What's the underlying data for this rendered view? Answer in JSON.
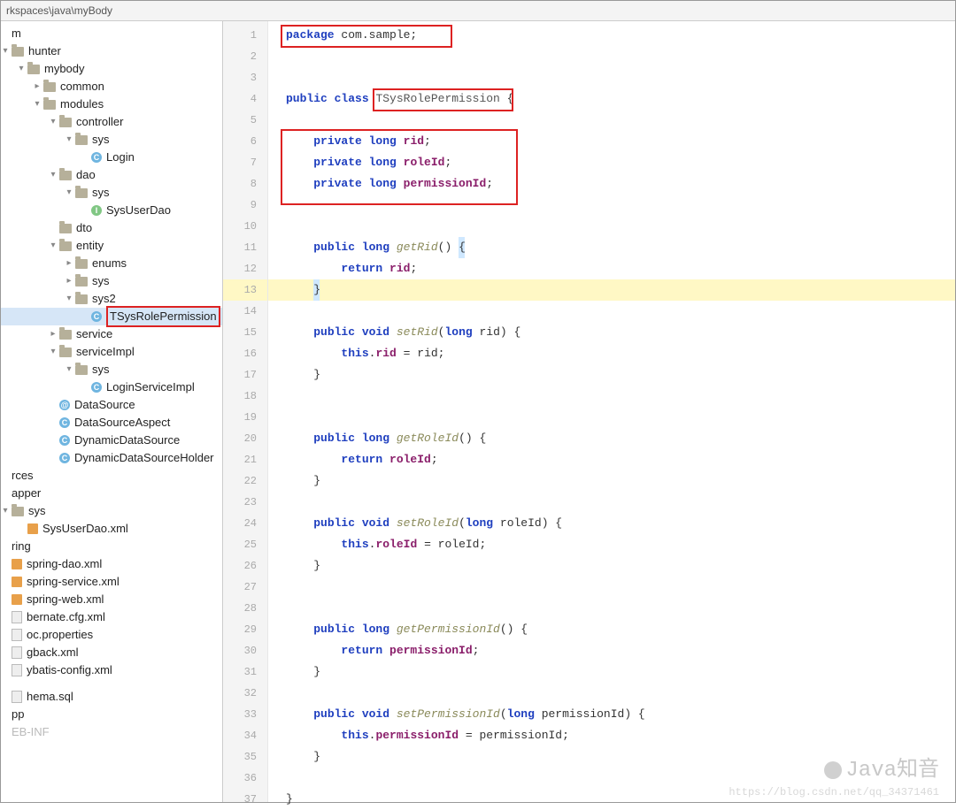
{
  "pathbar": "rkspaces\\java\\myBody",
  "tree": {
    "hunter": "hunter",
    "mybody": "mybody",
    "common": "common",
    "modules": "modules",
    "controller": "controller",
    "ctrl_sys": "sys",
    "Login": "Login",
    "dao": "dao",
    "dao_sys": "sys",
    "SysUserDao": "SysUserDao",
    "dto": "dto",
    "entity": "entity",
    "enums": "enums",
    "sys": "sys",
    "sys2": "sys2",
    "TSysRolePermission": "TSysRolePermission",
    "service": "service",
    "serviceImpl": "serviceImpl",
    "si_sys": "sys",
    "LoginServiceImpl": "LoginServiceImpl",
    "DataSource": "DataSource",
    "DataSourceAspect": "DataSourceAspect",
    "DynamicDataSource": "DynamicDataSource",
    "DynamicDataSourceHolder": "DynamicDataSourceHolder",
    "rces": "rces",
    "apper": "apper",
    "sys_folder": "sys",
    "SysUserDao_xml": "SysUserDao.xml",
    "ring": "ring",
    "spring_dao": "spring-dao.xml",
    "spring_service": "spring-service.xml",
    "spring_web": "spring-web.xml",
    "bernate": "bernate.cfg.xml",
    "oc_prop": "oc.properties",
    "gback": "gback.xml",
    "ybatis": "ybatis-config.xml",
    "hema": "hema.sql",
    "pp": "pp",
    "inf": "EB-INF",
    "m": "m"
  },
  "code": {
    "l1_a": "package",
    "l1_b": " com.sample;",
    "l4_a": "public class",
    "l4_cn": "TSysRolePermission",
    "l4_c": " {",
    "l6_a": "private long ",
    "l6_f": "rid",
    "l6_s": ";",
    "l7_a": "private long ",
    "l7_f": "roleId",
    "l7_s": ";",
    "l8_a": "private long ",
    "l8_f": "permissionId",
    "l8_s": ";",
    "l11_a": "public long ",
    "l11_m": "getRid",
    "l11_b": "() ",
    "l11_c": "{",
    "l12_a": "return ",
    "l12_f": "rid",
    "l12_s": ";",
    "l13": "}",
    "l15_a": "public void ",
    "l15_m": "setRid",
    "l15_b": "(",
    "l15_k": "long",
    "l15_c": " rid) {",
    "l16_a": "this",
    "l16_b": ".",
    "l16_f": "rid",
    "l16_c": " = rid;",
    "l17": "}",
    "l20_a": "public long ",
    "l20_m": "getRoleId",
    "l20_b": "() {",
    "l21_a": "return ",
    "l21_f": "roleId",
    "l21_s": ";",
    "l22": "}",
    "l24_a": "public void ",
    "l24_m": "setRoleId",
    "l24_b": "(",
    "l24_k": "long",
    "l24_c": " roleId) {",
    "l25_a": "this",
    "l25_b": ".",
    "l25_f": "roleId",
    "l25_c": " = roleId;",
    "l26": "}",
    "l29_a": "public long ",
    "l29_m": "getPermissionId",
    "l29_b": "() {",
    "l30_a": "return ",
    "l30_f": "permissionId",
    "l30_s": ";",
    "l31": "}",
    "l33_a": "public void ",
    "l33_m": "setPermissionId",
    "l33_b": "(",
    "l33_k": "long",
    "l33_c": " permissionId) {",
    "l34_a": "this",
    "l34_b": ".",
    "l34_f": "permissionId",
    "l34_c": " = permissionId;",
    "l35": "}",
    "l37": "}"
  },
  "lines": [
    "1",
    "2",
    "3",
    "4",
    "5",
    "6",
    "7",
    "8",
    "9",
    "10",
    "11",
    "12",
    "13",
    "14",
    "15",
    "16",
    "17",
    "18",
    "19",
    "20",
    "21",
    "22",
    "23",
    "24",
    "25",
    "26",
    "27",
    "28",
    "29",
    "30",
    "31",
    "32",
    "33",
    "34",
    "35",
    "36",
    "37"
  ],
  "watermark": "Java知音",
  "watermark2": "https://blog.csdn.net/qq_34371461"
}
